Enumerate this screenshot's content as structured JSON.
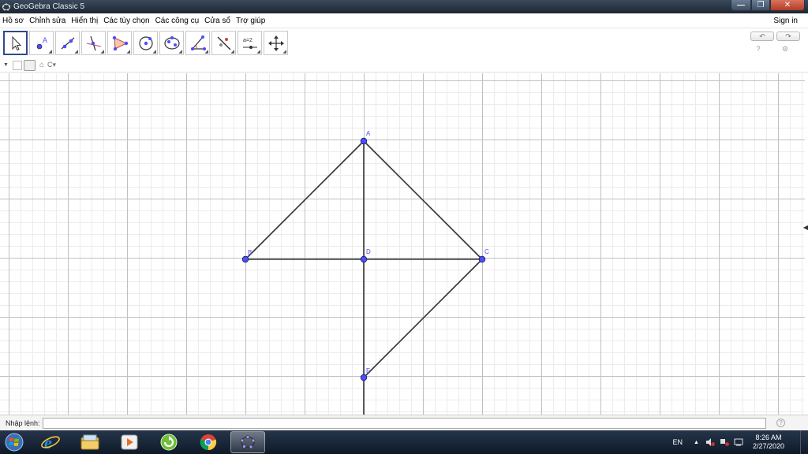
{
  "window": {
    "title": "GeoGebra Classic 5",
    "controls": {
      "minimize": "—",
      "maximize": "❐",
      "close": "✕"
    }
  },
  "menu": {
    "items": [
      "Hồ sơ",
      "Chỉnh sửa",
      "Hiển thị",
      "Các tùy chọn",
      "Các công cụ",
      "Cửa sổ",
      "Trợ giúp"
    ],
    "sign_in": "Sign in"
  },
  "toolbar": {
    "tools": [
      {
        "name": "move-tool",
        "icon": "cursor-arrow-icon"
      },
      {
        "name": "point-tool",
        "icon": "point-icon",
        "label": "A"
      },
      {
        "name": "line-tool",
        "icon": "line-icon"
      },
      {
        "name": "perpendicular-line-tool",
        "icon": "perpendicular-icon"
      },
      {
        "name": "polygon-tool",
        "icon": "polygon-icon"
      },
      {
        "name": "circle-tool",
        "icon": "circle-icon"
      },
      {
        "name": "ellipse-tool",
        "icon": "ellipse-icon"
      },
      {
        "name": "angle-tool",
        "icon": "angle-icon"
      },
      {
        "name": "reflect-tool",
        "icon": "reflect-icon"
      },
      {
        "name": "slider-tool",
        "icon": "slider-icon",
        "label": "a=2"
      },
      {
        "name": "move-graphics-view-tool",
        "icon": "move-view-icon"
      }
    ],
    "undo": "↶",
    "redo": "↷",
    "help_icon": "?",
    "settings_icon": "⚙"
  },
  "stylebar": {
    "caption_toggle": "C"
  },
  "graphics": {
    "points": [
      {
        "label": "A"
      },
      {
        "label": "B"
      },
      {
        "label": "C"
      },
      {
        "label": "D"
      },
      {
        "label": "E"
      }
    ],
    "colors": {
      "point": "#4d4dff",
      "line": "#333333",
      "label": "#4d4dff",
      "grid_major": "#c0c0c0",
      "grid_minor": "#ececec"
    }
  },
  "input_bar": {
    "label": "Nhập lệnh:",
    "value": "",
    "help": "?"
  },
  "taskbar": {
    "apps": [
      "windows-start-icon",
      "internet-explorer-icon",
      "file-explorer-icon",
      "media-player-icon",
      "green-app-icon",
      "chrome-icon",
      "geogebra-icon"
    ],
    "language": "EN",
    "time": "8:26 AM",
    "date": "2/27/2020"
  }
}
